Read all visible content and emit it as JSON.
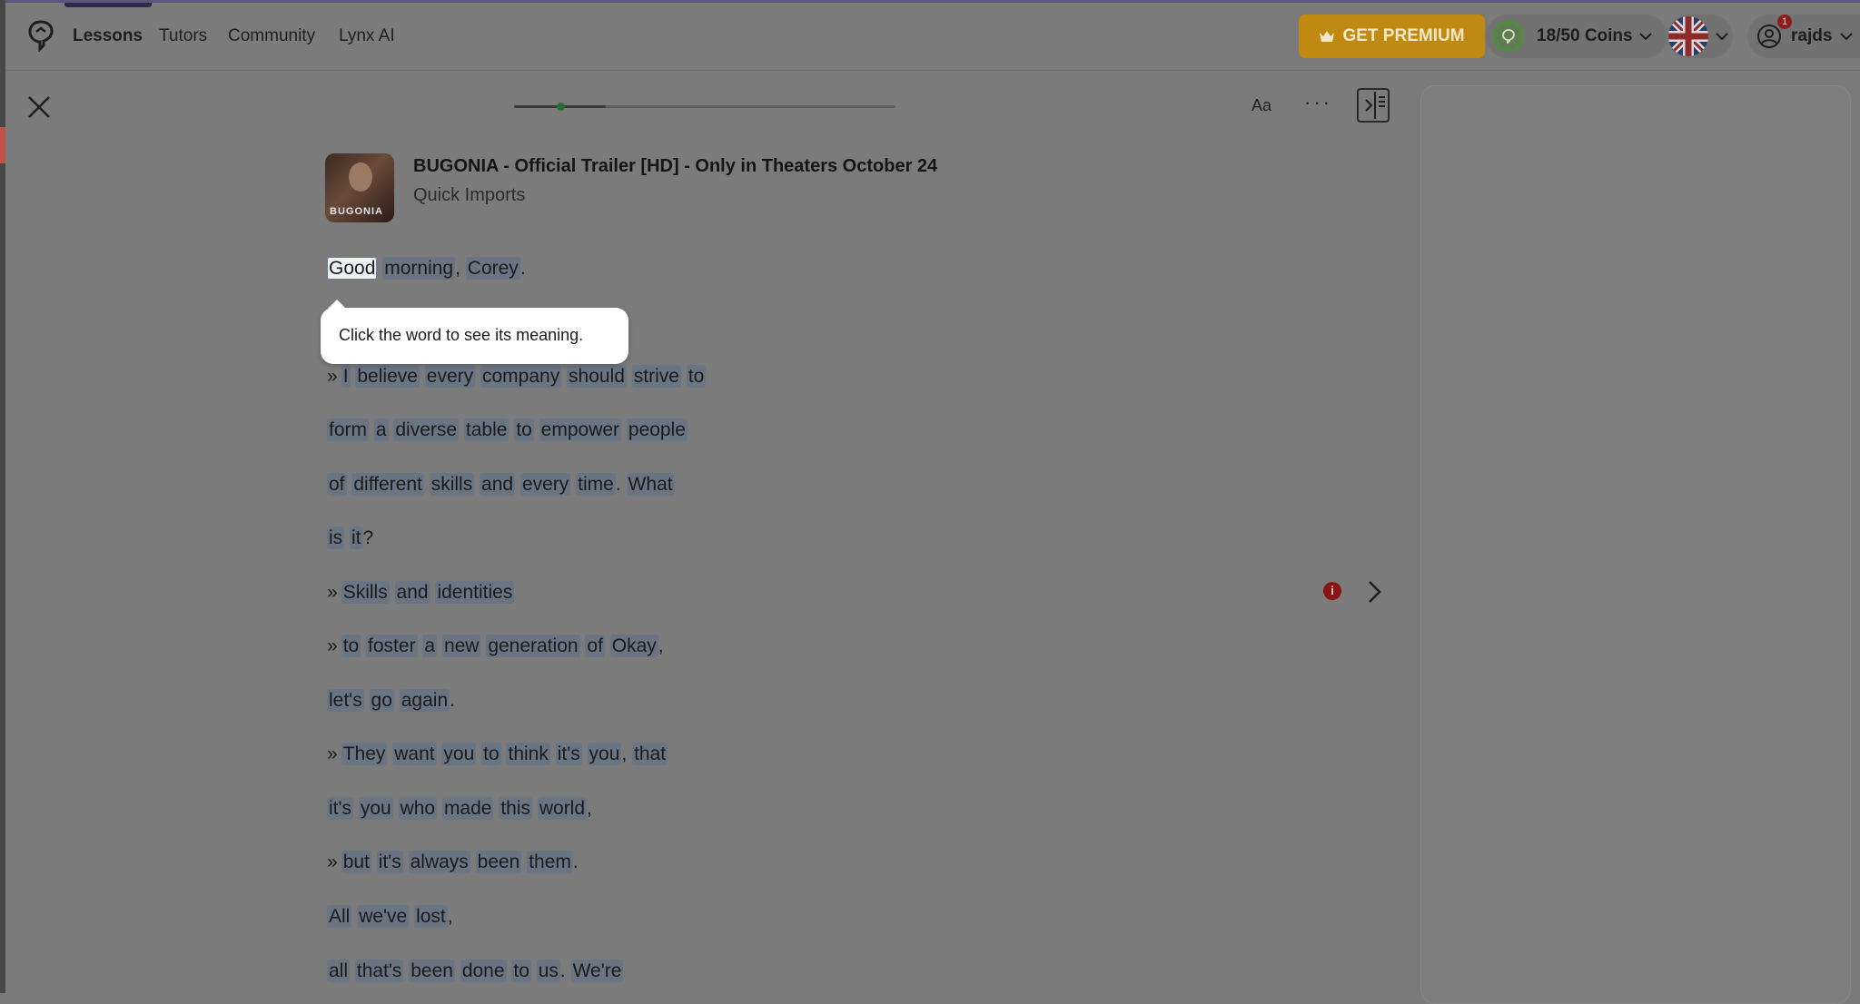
{
  "nav": {
    "links": [
      "Lessons",
      "Tutors",
      "Community",
      "Lynx AI"
    ],
    "premium_label": "GET PREMIUM",
    "coins_label": "18/50 Coins",
    "notification_count": "1",
    "username": "rajds"
  },
  "toolbar": {
    "font_label": "Aa",
    "more_label": "···"
  },
  "lesson": {
    "title": "BUGONIA - Official Trailer [HD] - Only in Theaters October 24",
    "subtitle": "Quick Imports",
    "thumb_text": "BUGONIA",
    "progress_fraction": 0.24
  },
  "tooltip": {
    "text": "Click the word to see its meaning."
  },
  "transcript": [
    {
      "marker": "",
      "words": [
        "Good",
        "morning",
        ",",
        "Corey",
        "."
      ],
      "selected": 0
    },
    {
      "marker": "»",
      "words": [
        "I",
        "believe",
        "every",
        "company",
        "should",
        "strive",
        "to"
      ]
    },
    {
      "marker": "",
      "words": [
        "form",
        "a",
        "diverse",
        "table",
        "to",
        "empower",
        "people"
      ]
    },
    {
      "marker": "",
      "words": [
        "of",
        "different",
        "skills",
        "and",
        "every",
        "time",
        ".",
        "What"
      ]
    },
    {
      "marker": "",
      "words": [
        "is",
        "it",
        "?"
      ]
    },
    {
      "marker": "»",
      "words": [
        "Skills",
        "and",
        "identities"
      ]
    },
    {
      "marker": "»",
      "words": [
        "to",
        "foster",
        "a",
        "new",
        "generation",
        "of",
        "Okay",
        ","
      ]
    },
    {
      "marker": "",
      "words": [
        "let's",
        "go",
        "again",
        "."
      ]
    },
    {
      "marker": "»",
      "words": [
        "They",
        "want",
        "you",
        "to",
        "think",
        "it's",
        "you",
        ",",
        "that"
      ]
    },
    {
      "marker": "",
      "words": [
        "it's",
        "you",
        "who",
        "made",
        "this",
        "world",
        ","
      ]
    },
    {
      "marker": "»",
      "words": [
        "but",
        "it's",
        "always",
        "been",
        "them",
        "."
      ]
    },
    {
      "marker": "",
      "words": [
        "All",
        "we've",
        "lost",
        ","
      ]
    },
    {
      "marker": "",
      "words": [
        "all",
        "that's",
        "been",
        "done",
        "to",
        "us",
        ".",
        "We're"
      ]
    }
  ]
}
